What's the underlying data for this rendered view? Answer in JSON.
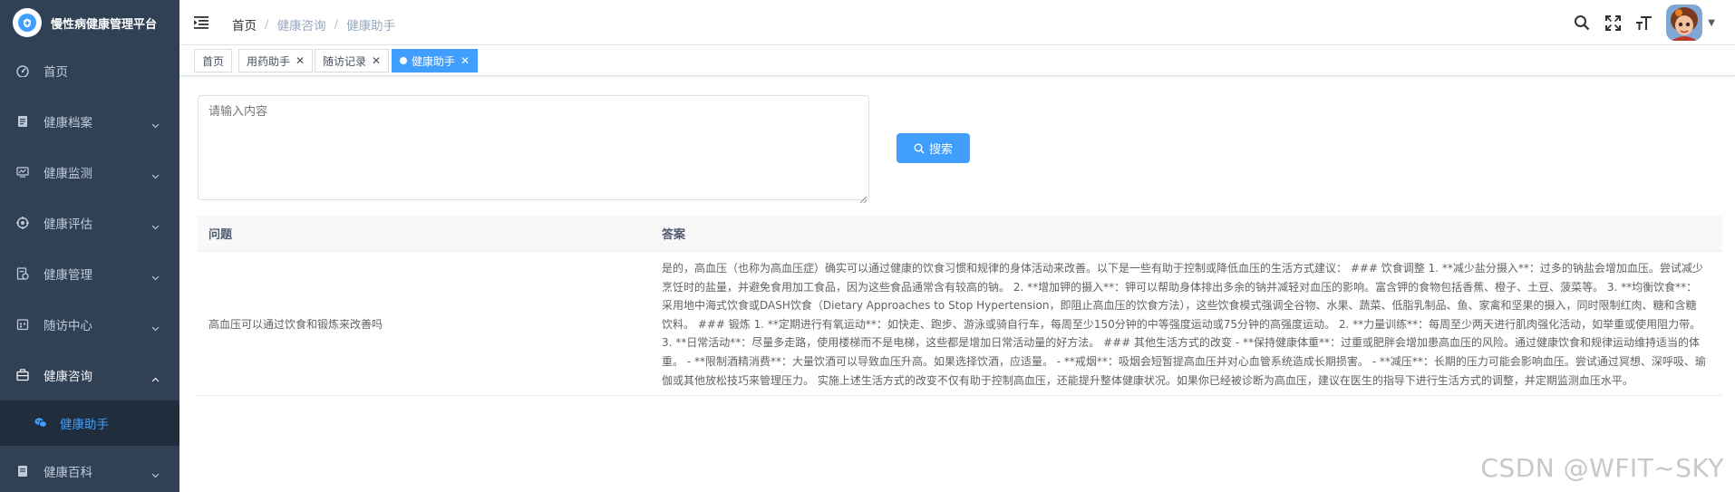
{
  "app": {
    "title": "慢性病健康管理平台"
  },
  "sidebar": {
    "items": [
      {
        "label": "首页",
        "icon": "dashboard-icon"
      },
      {
        "label": "健康档案",
        "icon": "document-icon"
      },
      {
        "label": "健康监测",
        "icon": "monitor-icon"
      },
      {
        "label": "健康评估",
        "icon": "assess-icon"
      },
      {
        "label": "健康管理",
        "icon": "manage-icon"
      },
      {
        "label": "随访中心",
        "icon": "calendar-icon"
      },
      {
        "label": "健康咨询",
        "icon": "consult-icon"
      },
      {
        "label": "健康百科",
        "icon": "book-icon"
      }
    ],
    "subitem": {
      "label": "健康助手",
      "icon": "wechat-icon"
    }
  },
  "breadcrumb": {
    "home": "首页",
    "level1": "健康咨询",
    "level2": "健康助手"
  },
  "tags": [
    {
      "label": "首页"
    },
    {
      "label": "用药助手"
    },
    {
      "label": "随访记录"
    },
    {
      "label": "健康助手"
    }
  ],
  "query": {
    "placeholder": "请输入内容",
    "value": ""
  },
  "search_button": {
    "label": "搜索"
  },
  "table": {
    "headers": {
      "question": "问题",
      "answer": "答案"
    },
    "rows": [
      {
        "question": "高血压可以通过饮食和锻炼来改善吗",
        "answer": "是的，高血压（也称为高血压症）确实可以通过健康的饮食习惯和规律的身体活动来改善。以下是一些有助于控制或降低血压的生活方式建议： ### 饮食调整 1. **减少盐分摄入**：过多的钠盐会增加血压。尝试减少烹饪时的盐量，并避免食用加工食品，因为这些食品通常含有较高的钠。 2. **增加钾的摄入**：钾可以帮助身体排出多余的钠并减轻对血压的影响。富含钾的食物包括香蕉、橙子、土豆、菠菜等。 3. **均衡饮食**：采用地中海式饮食或DASH饮食（Dietary Approaches to Stop Hypertension，即阻止高血压的饮食方法），这些饮食模式强调全谷物、水果、蔬菜、低脂乳制品、鱼、家禽和坚果的摄入，同时限制红肉、糖和含糖饮料。 ### 锻炼 1. **定期进行有氧运动**：如快走、跑步、游泳或骑自行车，每周至少150分钟的中等强度运动或75分钟的高强度运动。 2. **力量训练**：每周至少两天进行肌肉强化活动，如举重或使用阻力带。 3. **日常活动**：尽量多走路，使用楼梯而不是电梯，这些都是增加日常活动量的好方法。 ### 其他生活方式的改变 - **保持健康体重**：过重或肥胖会增加患高血压的风险。通过健康饮食和规律运动维持适当的体重。 - **限制酒精消费**：大量饮酒可以导致血压升高。如果选择饮酒，应适量。 - **戒烟**：吸烟会短暂提高血压并对心血管系统造成长期损害。 - **减压**：长期的压力可能会影响血压。尝试通过冥想、深呼吸、瑜伽或其他放松技巧来管理压力。 实施上述生活方式的改变不仅有助于控制高血压，还能提升整体健康状况。如果你已经被诊断为高血压，建议在医生的指导下进行生活方式的调整，并定期监测血压水平。"
      }
    ]
  },
  "watermark": "CSDN @WFIT~SKY",
  "colors": {
    "sidebar_bg": "#304156",
    "accent": "#409eff",
    "submenu_bg": "#1f2d3d"
  }
}
